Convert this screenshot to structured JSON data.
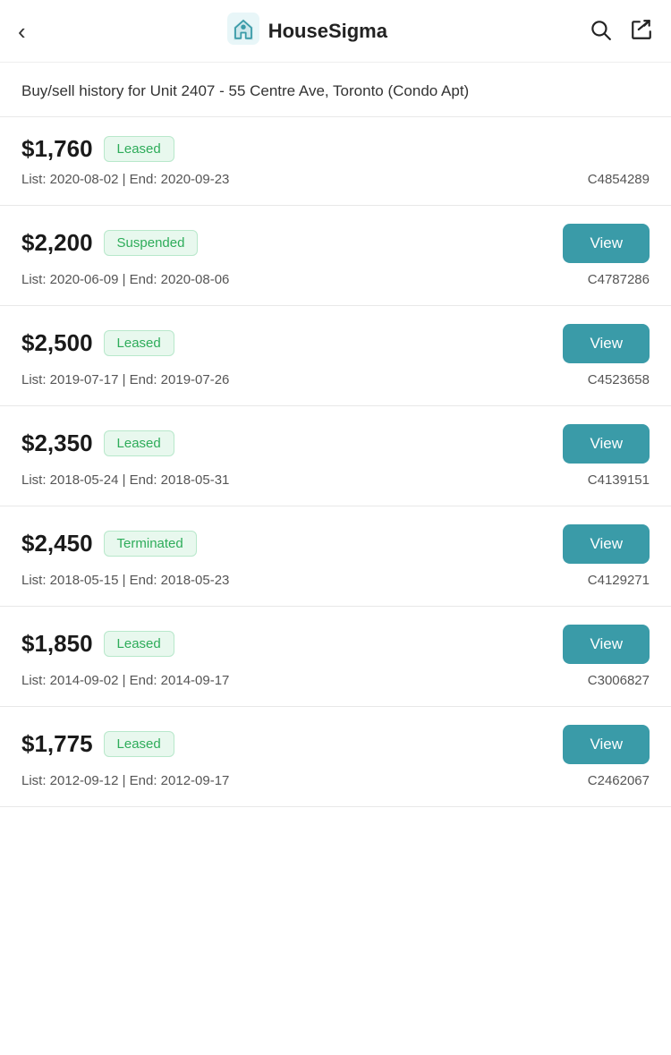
{
  "header": {
    "title": "HouseSigma",
    "back_label": "‹",
    "search_icon": "search-icon",
    "share_icon": "share-icon"
  },
  "page": {
    "subtitle": "Buy/sell history for Unit 2407 - 55 Centre Ave, Toronto (Condo Apt)"
  },
  "listings": [
    {
      "price": "$1,760",
      "status": "Leased",
      "status_type": "leased",
      "has_view_button": false,
      "dates": "List: 2020-08-02 | End: 2020-09-23",
      "listing_id": "C4854289"
    },
    {
      "price": "$2,200",
      "status": "Suspended",
      "status_type": "suspended",
      "has_view_button": true,
      "dates": "List: 2020-06-09 | End: 2020-08-06",
      "listing_id": "C4787286"
    },
    {
      "price": "$2,500",
      "status": "Leased",
      "status_type": "leased",
      "has_view_button": true,
      "dates": "List: 2019-07-17 | End: 2019-07-26",
      "listing_id": "C4523658"
    },
    {
      "price": "$2,350",
      "status": "Leased",
      "status_type": "leased",
      "has_view_button": true,
      "dates": "List: 2018-05-24 | End: 2018-05-31",
      "listing_id": "C4139151"
    },
    {
      "price": "$2,450",
      "status": "Terminated",
      "status_type": "terminated",
      "has_view_button": true,
      "dates": "List: 2018-05-15 | End: 2018-05-23",
      "listing_id": "C4129271"
    },
    {
      "price": "$1,850",
      "status": "Leased",
      "status_type": "leased",
      "has_view_button": true,
      "dates": "List: 2014-09-02 | End: 2014-09-17",
      "listing_id": "C3006827"
    },
    {
      "price": "$1,775",
      "status": "Leased",
      "status_type": "leased",
      "has_view_button": true,
      "dates": "List: 2012-09-12 | End: 2012-09-17",
      "listing_id": "C2462067"
    }
  ],
  "view_button_label": "View"
}
